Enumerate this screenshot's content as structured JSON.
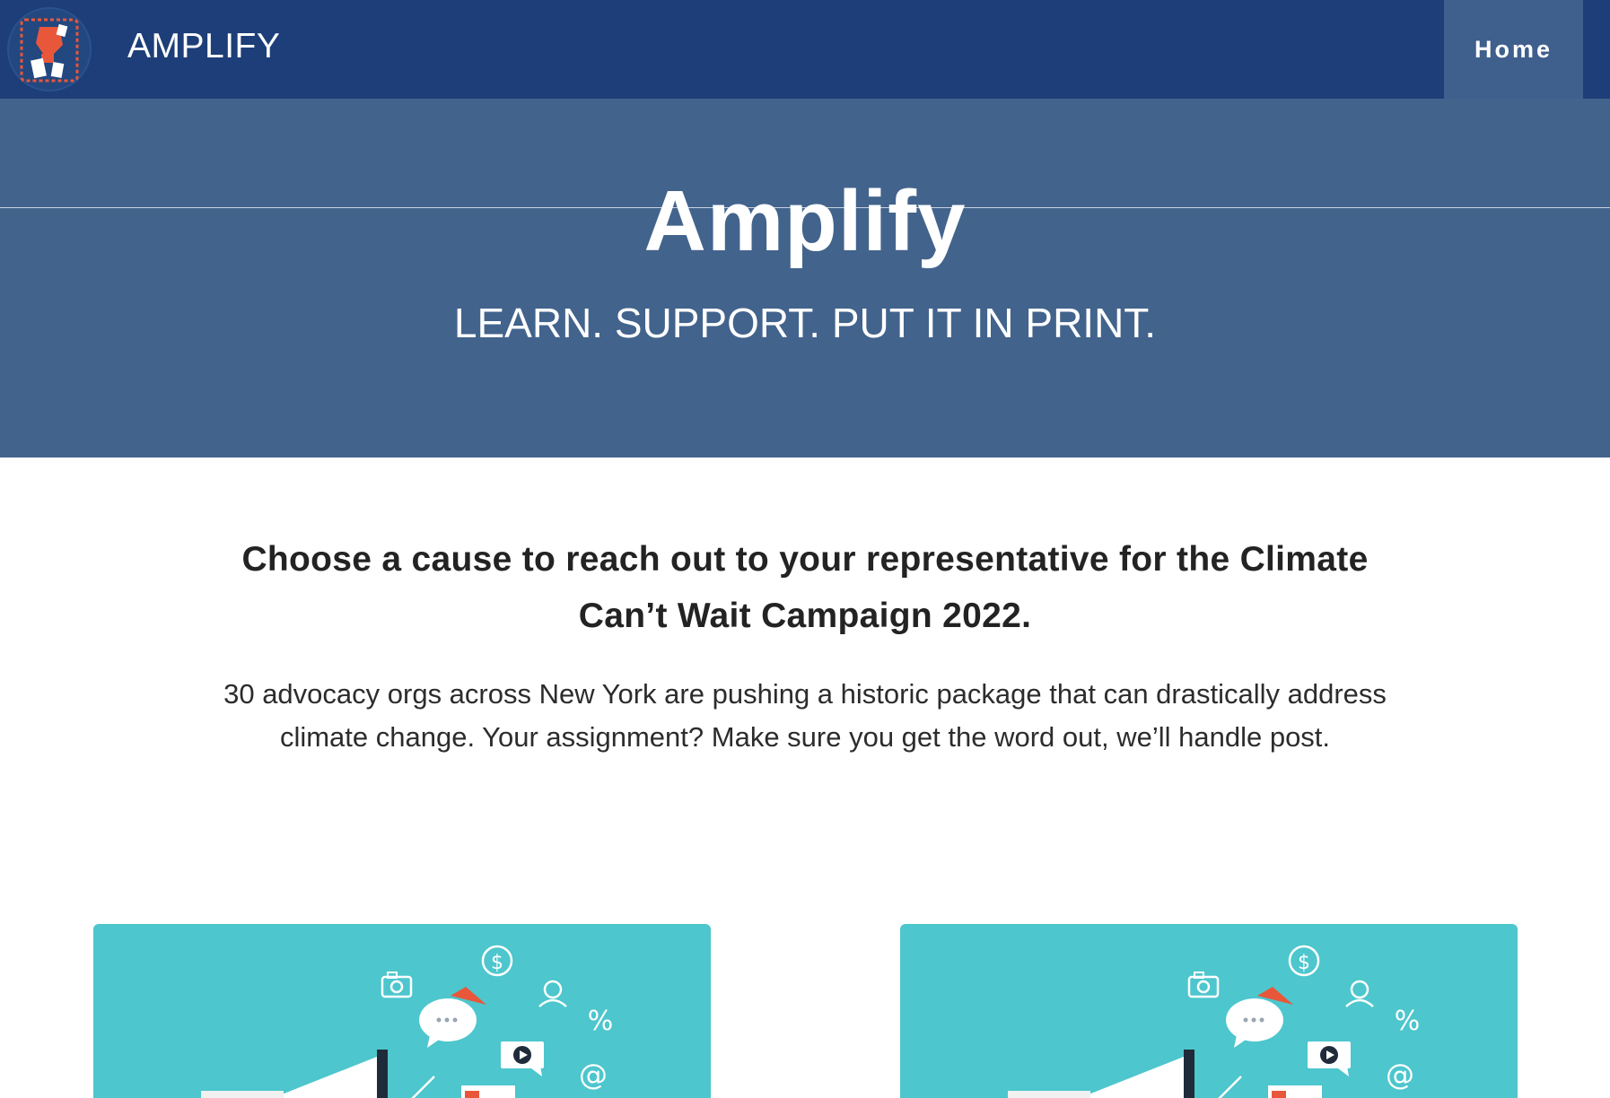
{
  "navbar": {
    "brand": "AMPLIFY",
    "home_label": "Home"
  },
  "hero": {
    "title": "Amplify",
    "tagline": "LEARN. SUPPORT. PUT IT IN PRINT."
  },
  "intro": {
    "heading": "Choose a cause to reach out to your representative for the Climate Can’t Wait Campaign 2022.",
    "body": "30 advocacy orgs across New York are pushing a historic package that can drastically address climate change. Your assignment? Make sure you get the word out, we’ll handle post."
  },
  "cards": [
    {
      "illustration": "megaphone-social-icons-illustration"
    },
    {
      "illustration": "megaphone-social-icons-illustration"
    }
  ],
  "colors": {
    "navbar": "#1d3e78",
    "hero": "#42638c",
    "home_tab": "#3f5f8d",
    "card": "#4dc6cd",
    "accent": "#e8573a"
  }
}
